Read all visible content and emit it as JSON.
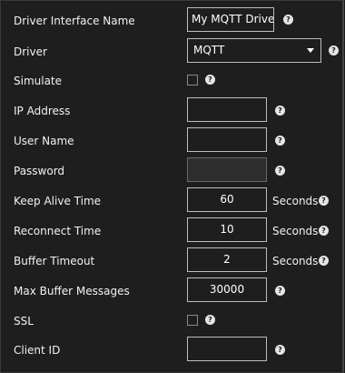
{
  "fields": {
    "driver_interface_name": {
      "label": "Driver Interface Name",
      "value": "My MQTT Driver"
    },
    "driver": {
      "label": "Driver",
      "value": "MQTT"
    },
    "simulate": {
      "label": "Simulate",
      "checked": false
    },
    "ip_address": {
      "label": "IP Address",
      "value": ""
    },
    "user_name": {
      "label": "User Name",
      "value": ""
    },
    "password": {
      "label": "Password",
      "value": ""
    },
    "keep_alive_time": {
      "label": "Keep Alive Time",
      "value": "60",
      "unit": "Seconds"
    },
    "reconnect_time": {
      "label": "Reconnect Time",
      "value": "10",
      "unit": "Seconds"
    },
    "buffer_timeout": {
      "label": "Buffer Timeout",
      "value": "2",
      "unit": "Seconds"
    },
    "max_buffer_messages": {
      "label": "Max Buffer Messages",
      "value": "30000"
    },
    "ssl": {
      "label": "SSL",
      "checked": false
    },
    "client_id": {
      "label": "Client ID",
      "value": ""
    }
  },
  "help_glyph": "?",
  "colors": {
    "background": "#1e1e1e",
    "text": "#ffffff",
    "border": "#bdbdbd",
    "disabled_field": "#2d2d2d"
  }
}
